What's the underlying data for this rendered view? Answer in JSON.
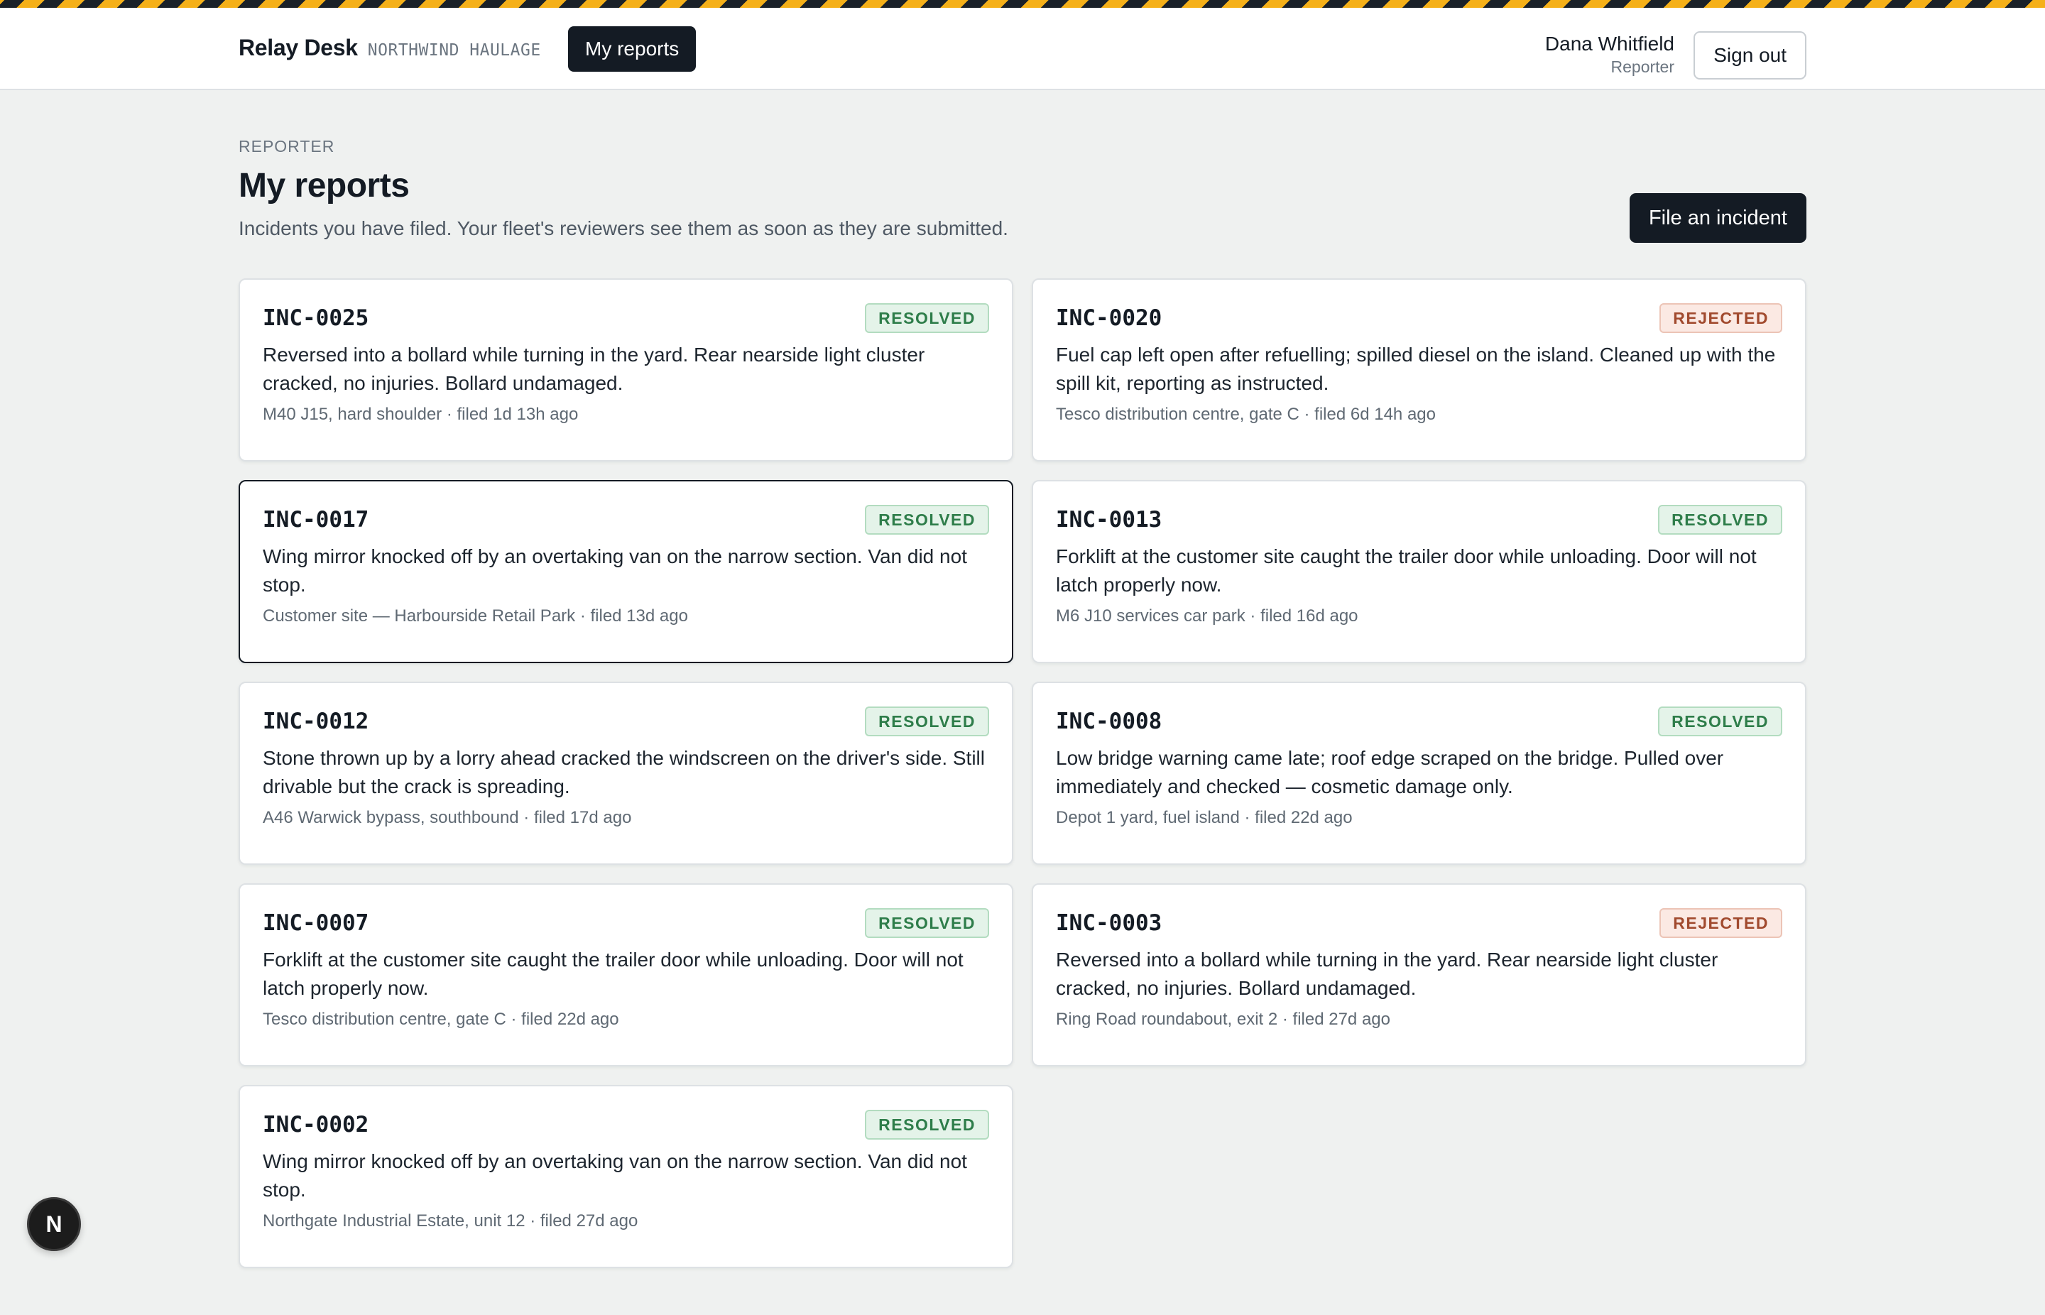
{
  "header": {
    "brand_name": "Relay Desk",
    "org_name": "NORTHWIND HAULAGE",
    "nav_label": "My reports",
    "user_name": "Dana Whitfield",
    "user_role": "Reporter",
    "signout_label": "Sign out"
  },
  "page": {
    "eyebrow": "REPORTER",
    "title": "My reports",
    "subtitle": "Incidents you have filed. Your fleet's reviewers see them as soon as they are submitted.",
    "file_button": "File an incident"
  },
  "status_colors": {
    "resolved": "#2e7d4a",
    "rejected": "#a14a2e"
  },
  "incidents": [
    {
      "id": "INC-0025",
      "status": "RESOLVED",
      "description": "Reversed into a bollard while turning in the yard. Rear nearside light cluster cracked, no injuries. Bollard undamaged.",
      "meta": "M40 J15, hard shoulder · filed 1d  13h  ago"
    },
    {
      "id": "INC-0020",
      "status": "REJECTED",
      "description": "Fuel cap left open after refuelling; spilled diesel on the island. Cleaned up with the spill kit, reporting as instructed.",
      "meta": "Tesco distribution centre, gate C · filed 6d  14h  ago"
    },
    {
      "id": "INC-0017",
      "status": "RESOLVED",
      "description": "Wing mirror knocked off by an overtaking van on the narrow section. Van did not stop.",
      "meta": "Customer site — Harbourside Retail Park · filed 13d  ago"
    },
    {
      "id": "INC-0013",
      "status": "RESOLVED",
      "description": "Forklift at the customer site caught the trailer door while unloading. Door will not latch properly now.",
      "meta": "M6 J10 services car park · filed 16d  ago"
    },
    {
      "id": "INC-0012",
      "status": "RESOLVED",
      "description": "Stone thrown up by a lorry ahead cracked the windscreen on the driver's side. Still drivable but the crack is spreading.",
      "meta": "A46 Warwick bypass, southbound · filed 17d  ago"
    },
    {
      "id": "INC-0008",
      "status": "RESOLVED",
      "description": "Low bridge warning came late; roof edge scraped on the bridge. Pulled over immediately and checked — cosmetic damage only.",
      "meta": "Depot 1 yard, fuel island · filed 22d  ago"
    },
    {
      "id": "INC-0007",
      "status": "RESOLVED",
      "description": "Forklift at the customer site caught the trailer door while unloading. Door will not latch properly now.",
      "meta": "Tesco distribution centre, gate C · filed 22d  ago"
    },
    {
      "id": "INC-0003",
      "status": "REJECTED",
      "description": "Reversed into a bollard while turning in the yard. Rear nearside light cluster cracked, no injuries. Bollard undamaged.",
      "meta": "Ring Road roundabout, exit 2 · filed 27d  ago"
    },
    {
      "id": "INC-0002",
      "status": "RESOLVED",
      "description": "Wing mirror knocked off by an overtaking van on the narrow section. Van did not stop.",
      "meta": "Northgate Industrial Estate, unit 12 · filed 27d  ago"
    }
  ],
  "dev_badge": "N"
}
